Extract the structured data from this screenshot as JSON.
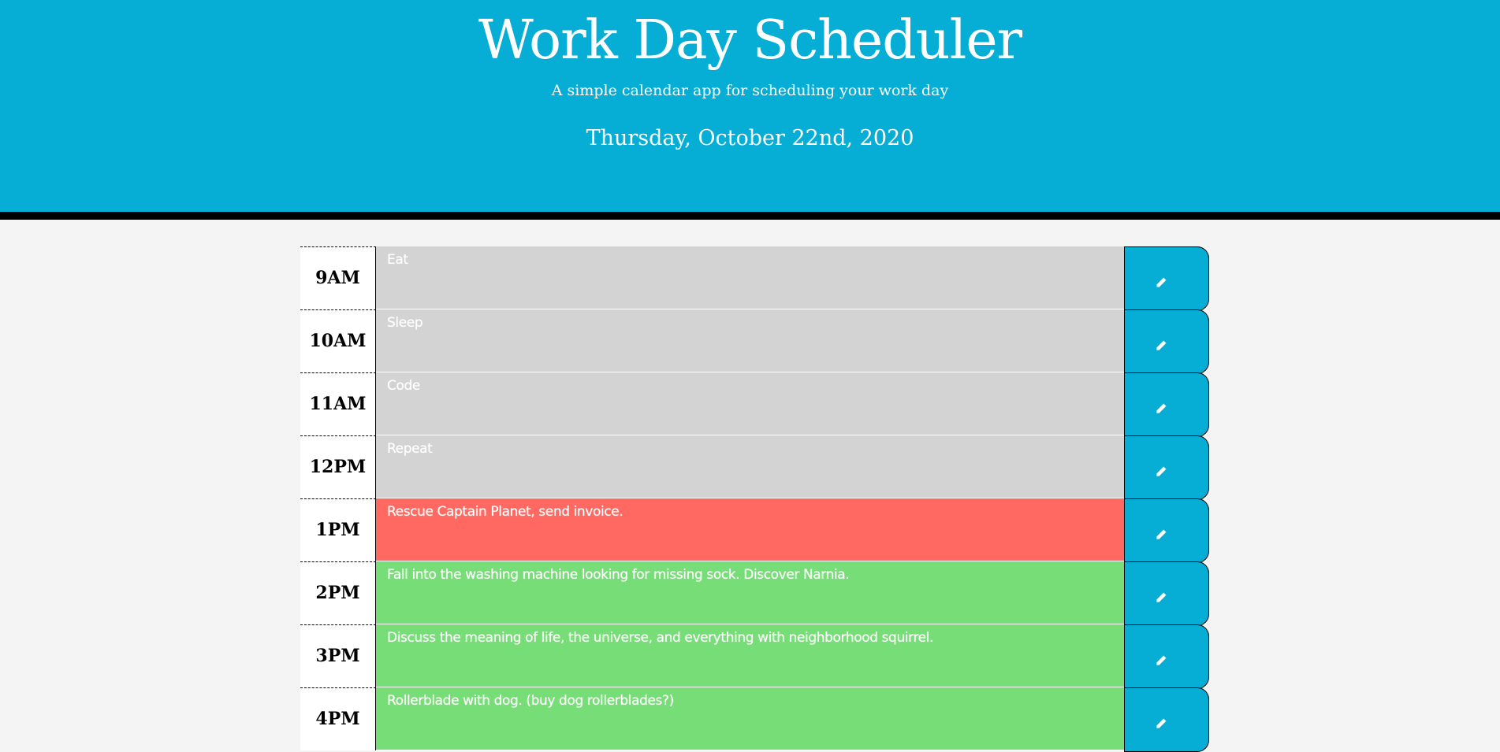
{
  "header": {
    "title": "Work Day Scheduler",
    "subtitle": "A simple calendar app for scheduling your work day",
    "current_date": "Thursday, October 22nd, 2020"
  },
  "schedule": [
    {
      "hour": "9AM",
      "text": "Eat",
      "state": "past"
    },
    {
      "hour": "10AM",
      "text": "Sleep",
      "state": "past"
    },
    {
      "hour": "11AM",
      "text": "Code",
      "state": "past"
    },
    {
      "hour": "12PM",
      "text": "Repeat",
      "state": "past"
    },
    {
      "hour": "1PM",
      "text": "Rescue Captain Planet, send invoice.",
      "state": "present"
    },
    {
      "hour": "2PM",
      "text": "Fall into the washing machine looking for missing sock. Discover Narnia.",
      "state": "future"
    },
    {
      "hour": "3PM",
      "text": "Discuss the meaning of life, the universe, and everything with neighborhood squirrel.",
      "state": "future"
    },
    {
      "hour": "4PM",
      "text": "Rollerblade with dog. (buy dog rollerblades?)",
      "state": "future"
    }
  ],
  "colors": {
    "header_bg": "#06aed5",
    "past": "#d3d3d3",
    "present": "#ff6961",
    "future": "#77dd77",
    "save_button": "#06aed5"
  },
  "icons": {
    "save_button": "pencil-icon"
  }
}
